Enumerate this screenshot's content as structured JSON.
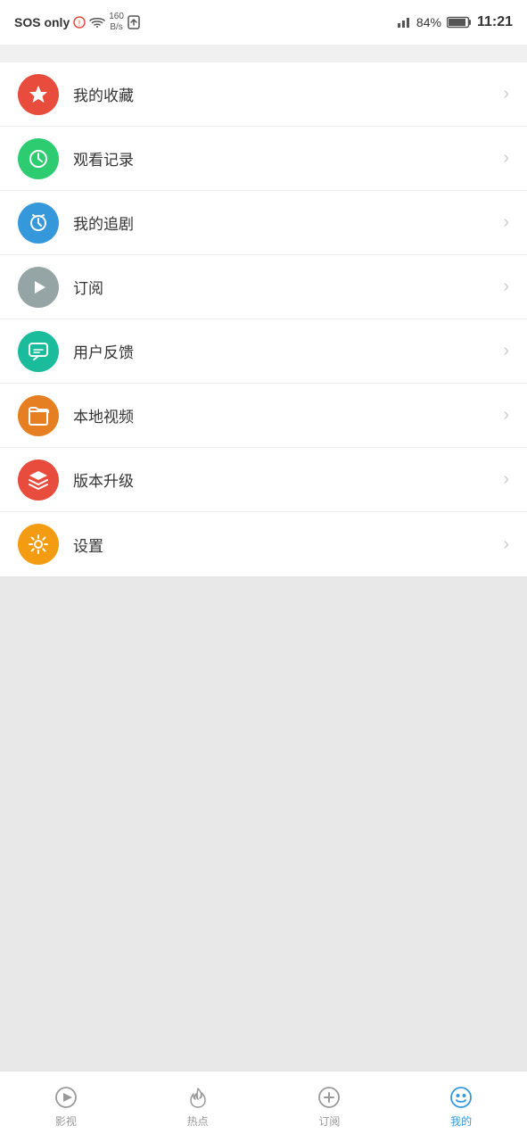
{
  "statusBar": {
    "sosText": "SOS only",
    "networkSpeed": "160\nB/s",
    "batteryPercent": "84%",
    "time": "11:21"
  },
  "menuItems": [
    {
      "id": "favorites",
      "label": "我的收藏",
      "iconColor": "icon-red",
      "iconType": "star"
    },
    {
      "id": "history",
      "label": "观看记录",
      "iconColor": "icon-green",
      "iconType": "clock"
    },
    {
      "id": "follow",
      "label": "我的追剧",
      "iconColor": "icon-blue",
      "iconType": "alarm"
    },
    {
      "id": "subscribe",
      "label": "订阅",
      "iconColor": "icon-gray",
      "iconType": "play"
    },
    {
      "id": "feedback",
      "label": "用户反馈",
      "iconColor": "icon-teal",
      "iconType": "message"
    },
    {
      "id": "local",
      "label": "本地视频",
      "iconColor": "icon-orange",
      "iconType": "folder"
    },
    {
      "id": "update",
      "label": "版本升级",
      "iconColor": "icon-salmon",
      "iconType": "layers"
    },
    {
      "id": "settings",
      "label": "设置",
      "iconColor": "icon-gold",
      "iconType": "gear"
    }
  ],
  "bottomNav": [
    {
      "id": "videos",
      "label": "影视",
      "iconType": "play-circle",
      "active": false
    },
    {
      "id": "hot",
      "label": "热点",
      "iconType": "fire",
      "active": false
    },
    {
      "id": "subscribe-nav",
      "label": "订阅",
      "iconType": "plus-circle",
      "active": false
    },
    {
      "id": "mine",
      "label": "我的",
      "iconType": "smiley",
      "active": true
    }
  ]
}
